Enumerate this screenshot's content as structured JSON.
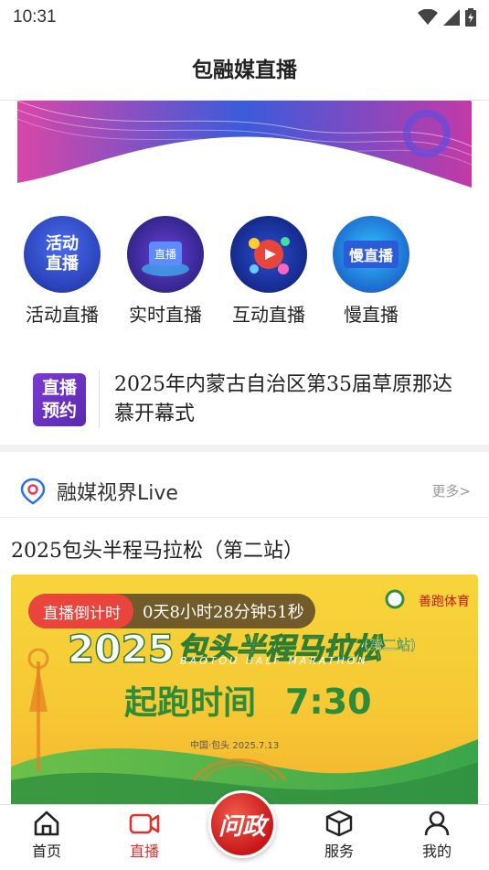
{
  "status": {
    "time": "10:31"
  },
  "header": {
    "title": "包融媒直播"
  },
  "quick_entries": [
    {
      "label": "活动直播",
      "icon_text": "活动\n直播",
      "icon": "activity-live-icon"
    },
    {
      "label": "实时直播",
      "icon_text": "直播",
      "icon": "realtime-live-icon"
    },
    {
      "label": "互动直播",
      "icon_text": "",
      "icon": "interactive-live-icon"
    },
    {
      "label": "慢直播",
      "icon_text": "慢直播",
      "icon": "slow-live-icon"
    }
  ],
  "reserve": {
    "badge_line1": "直播",
    "badge_line2": "预约",
    "title": "2025年内蒙古自治区第35届草原那达慕开幕式"
  },
  "live_section": {
    "title": "融媒视界Live",
    "more": "更多>"
  },
  "event": {
    "title": "2025包头半程马拉松（第二站）",
    "countdown_label": "直播倒计时",
    "countdown_value": "0天8小时28分钟51秒",
    "poster": {
      "brand": "善跑体育",
      "year": "2025",
      "name": "包头半程马拉松",
      "stage": "(第二站)",
      "english": "BAOTOU HALF MARATHON",
      "start_label": "起跑时间",
      "start_time": "7:30",
      "place_date": "中国·包头   2025.7.13"
    }
  },
  "tabbar": {
    "items": [
      {
        "label": "首页",
        "icon": "home-icon"
      },
      {
        "label": "直播",
        "icon": "video-icon"
      },
      {
        "label": "问政",
        "icon": "center-icon"
      },
      {
        "label": "服务",
        "icon": "box-icon"
      },
      {
        "label": "我的",
        "icon": "user-icon"
      }
    ],
    "active": "直播"
  },
  "colors": {
    "accent": "#e0312b",
    "badge": "#6a33c4"
  }
}
